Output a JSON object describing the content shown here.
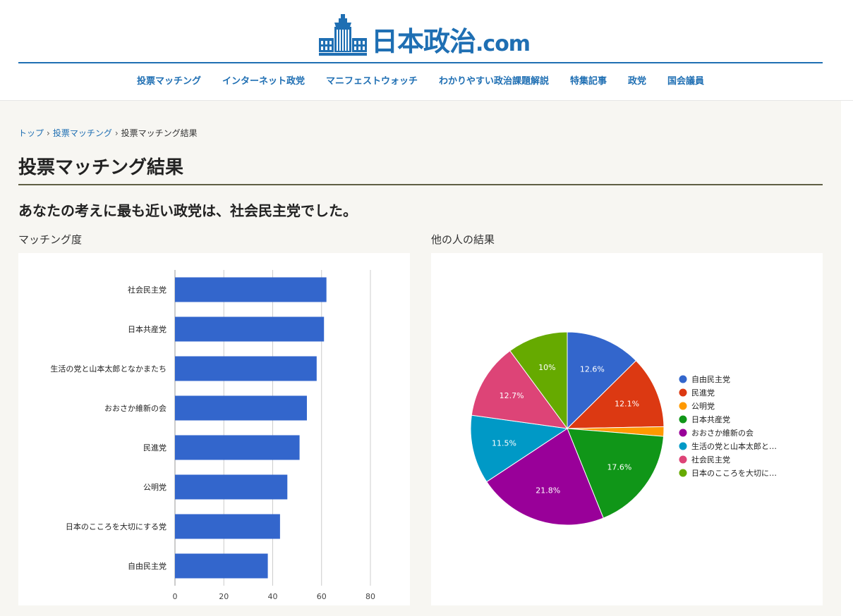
{
  "site": {
    "logo_text": "日本政治",
    "logo_suffix": ".com",
    "nav": [
      "投票マッチング",
      "インターネット政党",
      "マニフェストウォッチ",
      "わかりやすい政治課題解説",
      "特集記事",
      "政党",
      "国会議員"
    ]
  },
  "breadcrumb": {
    "top": "トップ",
    "matching": "投票マッチング",
    "current": "投票マッチング結果",
    "separator": "›"
  },
  "page": {
    "title": "投票マッチング結果",
    "result": "あなたの考えに最も近い政党は、社会民主党でした。",
    "left_label": "マッチング度",
    "right_label": "他の人の結果"
  },
  "colors": {
    "brand": "#1f6fb3",
    "bar": "#3366cc"
  },
  "chart_data": [
    {
      "type": "bar",
      "orientation": "horizontal",
      "title": "マッチング度",
      "categories": [
        "社会民主党",
        "日本共産党",
        "生活の党と山本太郎となかまたち",
        "おおさか維新の会",
        "民進党",
        "公明党",
        "日本のこころを大切にする党",
        "自由民主党"
      ],
      "values": [
        62,
        61,
        58,
        54,
        51,
        46,
        43,
        38
      ],
      "xlim": [
        0,
        80
      ],
      "ticks": [
        0,
        20,
        40,
        60,
        80
      ],
      "grid": true,
      "color": "#3366cc"
    },
    {
      "type": "pie",
      "title": "他の人の結果",
      "legend_position": "right",
      "slices": [
        {
          "label": "自由民主党",
          "value": 12.6,
          "display": "12.6%",
          "color": "#3366cc"
        },
        {
          "label": "民進党",
          "value": 12.1,
          "display": "12.1%",
          "color": "#dc3912"
        },
        {
          "label": "公明党",
          "value": 1.6,
          "display": "",
          "color": "#ff9900"
        },
        {
          "label": "日本共産党",
          "value": 17.6,
          "display": "17.6%",
          "color": "#109618"
        },
        {
          "label": "おおさか維新の会",
          "value": 21.8,
          "display": "21.8%",
          "color": "#990099"
        },
        {
          "label": "生活の党と山本太郎と…",
          "value": 11.5,
          "display": "11.5%",
          "color": "#0099c6"
        },
        {
          "label": "社会民主党",
          "value": 12.7,
          "display": "12.7%",
          "color": "#dd4477"
        },
        {
          "label": "日本のこころを大切に…",
          "value": 10.1,
          "display": "10%",
          "color": "#66aa00"
        }
      ]
    }
  ]
}
